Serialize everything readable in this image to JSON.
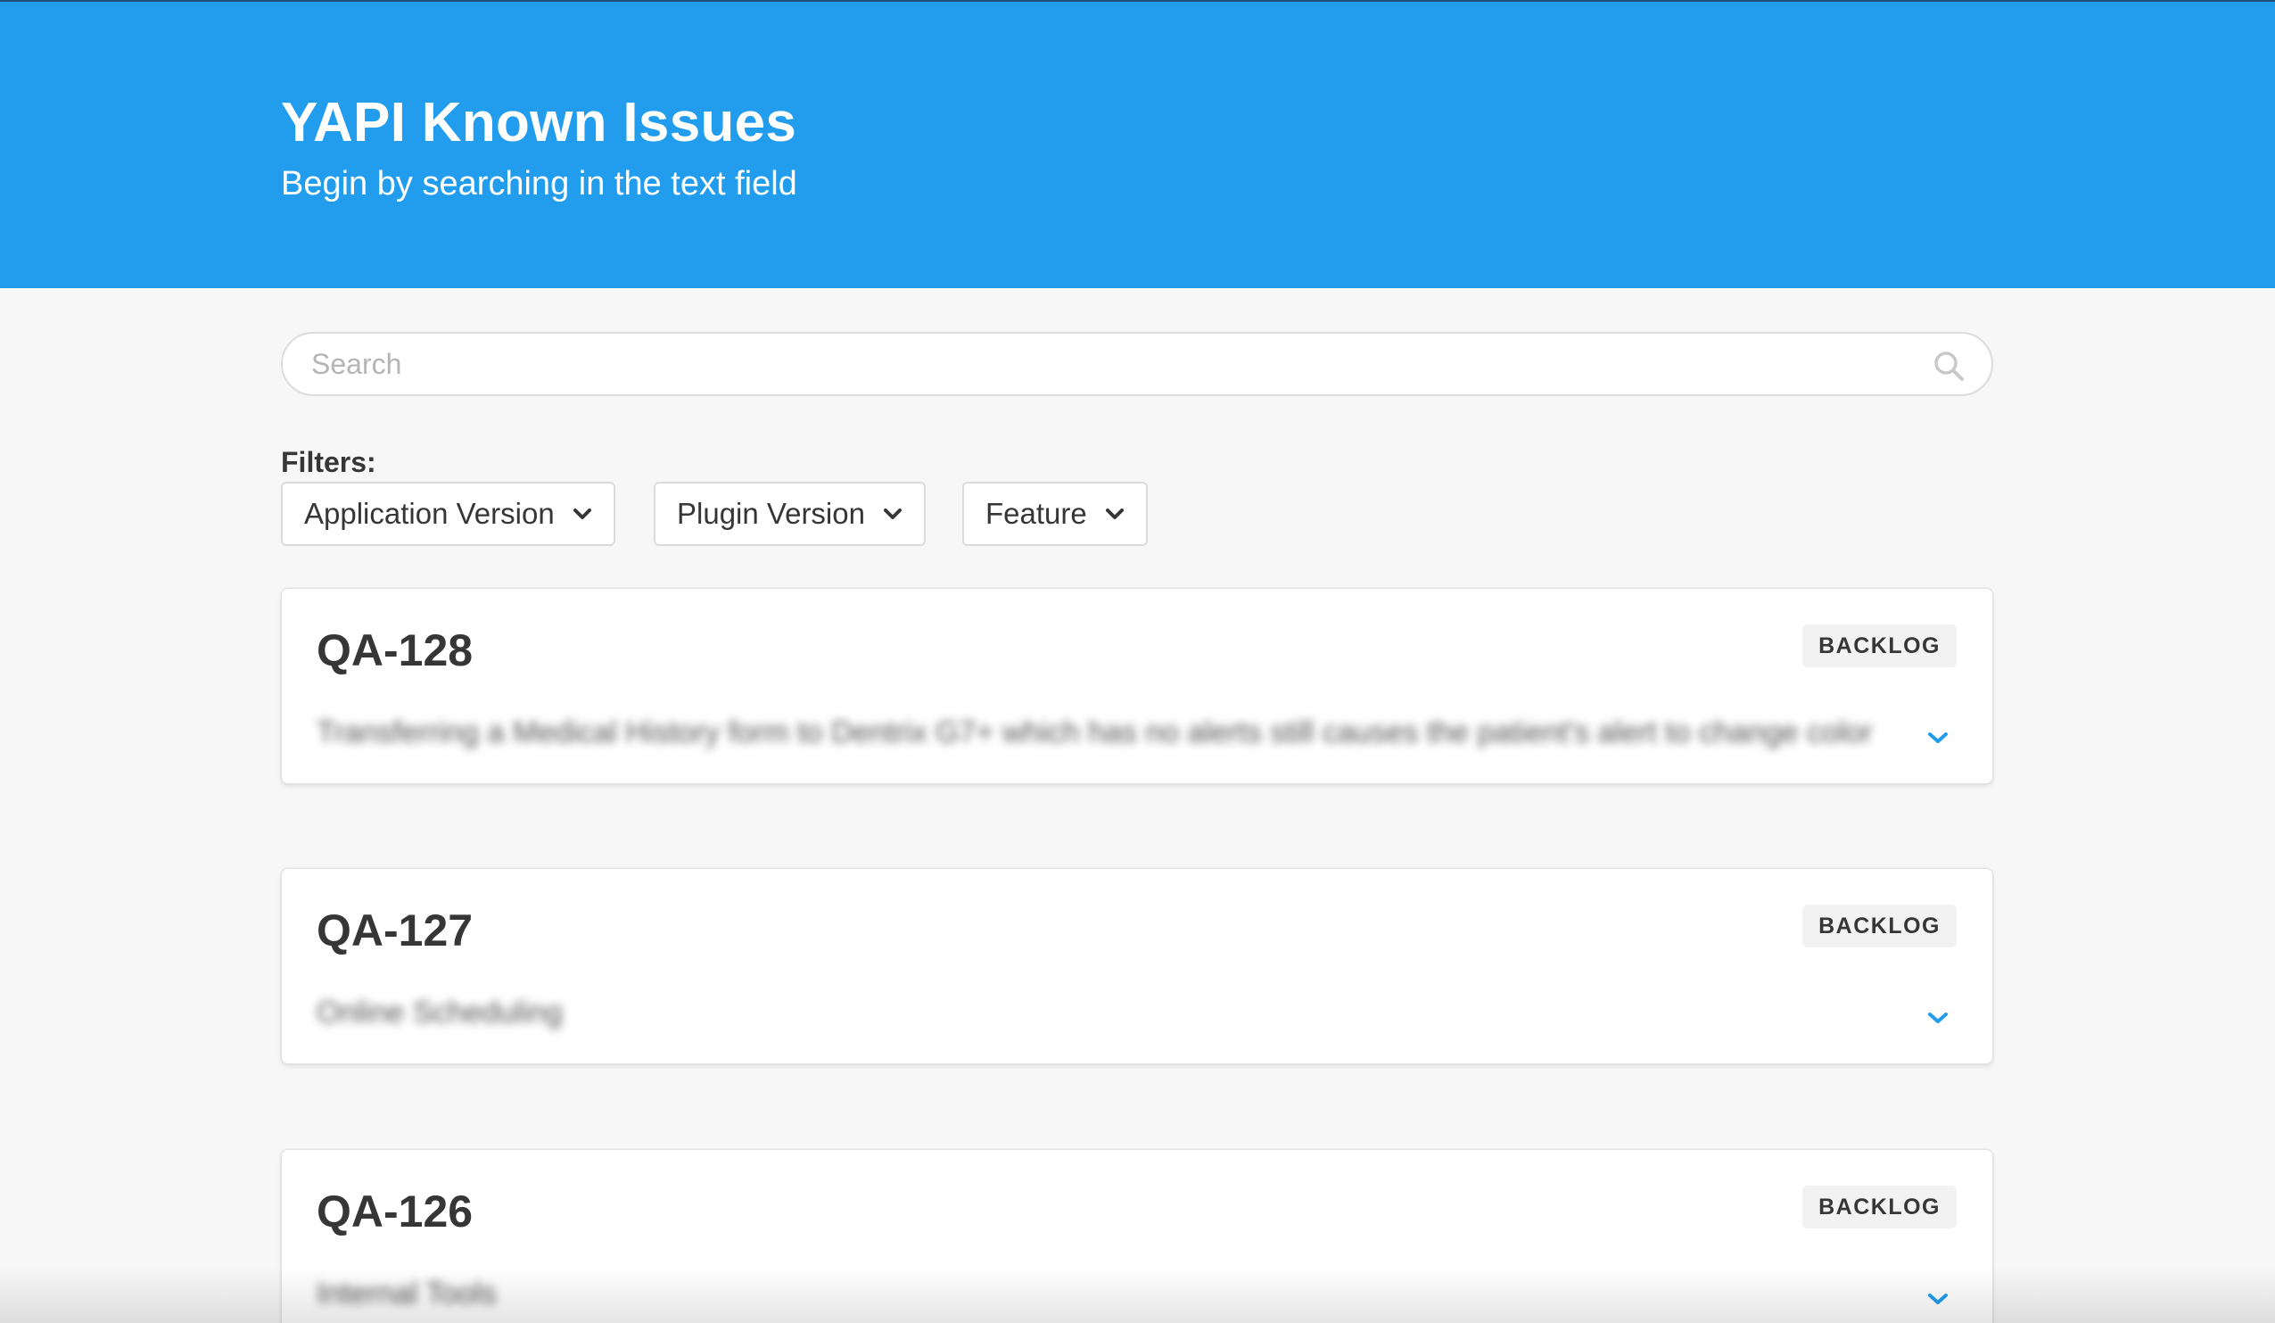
{
  "header": {
    "title": "YAPI Known Issues",
    "subtitle": "Begin by searching in the text field"
  },
  "search": {
    "placeholder": "Search",
    "value": ""
  },
  "filters": {
    "label": "Filters:",
    "options": [
      {
        "label": "Application Version"
      },
      {
        "label": "Plugin Version"
      },
      {
        "label": "Feature"
      }
    ]
  },
  "issues": [
    {
      "id": "QA-128",
      "status": "BACKLOG",
      "summary": "Transferring a Medical History form to Dentrix G7+ which has no alerts still causes the patient's alert to change color"
    },
    {
      "id": "QA-127",
      "status": "BACKLOG",
      "summary": "Online Scheduling"
    },
    {
      "id": "QA-126",
      "status": "BACKLOG",
      "summary": "Internal Tools"
    }
  ],
  "colors": {
    "header_bg": "#229ded",
    "accent": "#229ded",
    "page_bg": "#f7f7f7"
  }
}
